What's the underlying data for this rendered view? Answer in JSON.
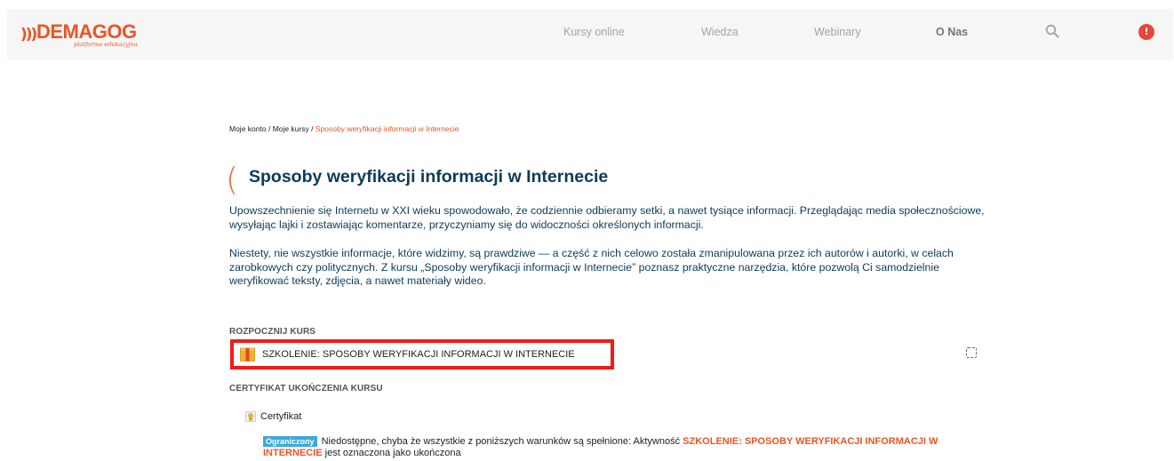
{
  "brand": {
    "name": "DEMAGOG",
    "tagline": "platforma edukacyjna",
    "color": "#e95524"
  },
  "nav": {
    "items": [
      {
        "label": "Kursy online"
      },
      {
        "label": "Wiedza"
      },
      {
        "label": "Webinary"
      },
      {
        "label": "O Nas"
      }
    ],
    "search_icon": "search-icon",
    "alert_icon": "alert-icon",
    "alert_glyph": "!"
  },
  "breadcrumb": {
    "items": [
      "Moje konto",
      "Moje kursy",
      "Sposoby weryfikacji informacji w Internecie"
    ],
    "separator": " / "
  },
  "course": {
    "title": "Sposoby weryfikacji informacji w Internecie",
    "paragraph1": "Upowszechnienie się Internetu w XXI wieku spowodowało, że codziennie odbieramy setki, a nawet tysiące informacji. Przeglądając media społecznościowe, wysyłając lajki i zostawiając komentarze, przyczyniamy się do widoczności określonych informacji.",
    "paragraph2": "Niestety, nie wszystkie informacje, które widzimy, są prawdziwe — a część z nich celowo została zmanipulowana przez ich autorów i autorki, w celach zarobkowych czy politycznych. Z kursu „Sposoby weryfikacji informacji w Internecie” poznasz praktyczne narzędzia, które pozwolą Ci samodzielnie weryfikować teksty, zdjęcia, a nawet materiały wideo."
  },
  "sections": [
    {
      "heading": "ROZPOCZNIJ KURS",
      "activity": {
        "name": "SZKOLENIE: SPOSOBY WERYFIKACJI INFORMACJI W INTERNECIE",
        "icon": "package-icon"
      }
    },
    {
      "heading": "CERTYFIKAT UKOŃCZENIA KURSU",
      "activity": {
        "name": "Certyfikat",
        "icon": "certificate-icon"
      },
      "restriction": {
        "badge": "Ograniczony",
        "text_before": "Niedostępne, chyba że wszystkie z poniższych warunków są spełnione: Aktywność ",
        "activity_link": "SZKOLENIE: SPOSOBY WERYFIKACJI INFORMACJI W INTERNECIE",
        "text_after": " jest oznaczona jako ukończona"
      }
    }
  ],
  "colors": {
    "accent": "#e95524",
    "title": "#0d3b57",
    "highlight_border": "#ee1c1c",
    "badge": "#3ba9da",
    "nav_text": "#9aa7b4"
  }
}
